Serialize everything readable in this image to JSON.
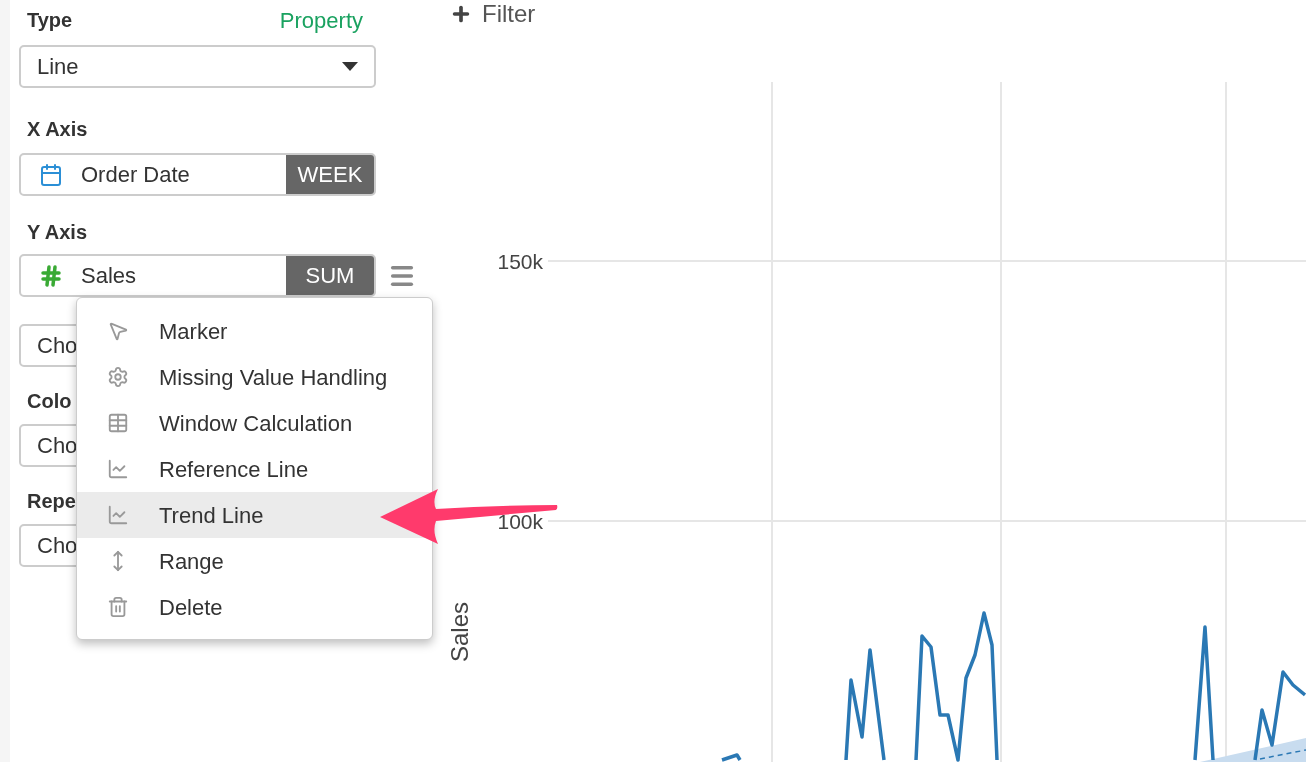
{
  "panel": {
    "type_label": "Type",
    "property_link": "Property",
    "type_select": {
      "value": "Line"
    },
    "x_axis": {
      "label": "X Axis",
      "field": "Order Date",
      "aggregation": "WEEK"
    },
    "y_axis": {
      "label": "Y Axis",
      "field": "Sales",
      "aggregation": "SUM"
    },
    "hidden_rows": [
      {
        "label": null,
        "field": "Cho"
      },
      {
        "label": "Colo",
        "field": "Cho"
      },
      {
        "label": "Repe",
        "field": "Cho"
      }
    ]
  },
  "menu": {
    "items": [
      {
        "kind": "marker",
        "label": "Marker",
        "highlighted": false
      },
      {
        "kind": "settings",
        "label": "Missing Value Handling",
        "highlighted": false
      },
      {
        "kind": "table",
        "label": "Window Calculation",
        "highlighted": false
      },
      {
        "kind": "chart",
        "label": "Reference Line",
        "highlighted": false
      },
      {
        "kind": "chart",
        "label": "Trend Line",
        "highlighted": true
      },
      {
        "kind": "range",
        "label": "Range",
        "highlighted": false
      },
      {
        "kind": "delete",
        "label": "Delete",
        "highlighted": false
      }
    ]
  },
  "filter_button": "Filter",
  "chart": {
    "y_ticks": [
      "150k",
      "100k"
    ],
    "y_label": "Sales"
  }
}
